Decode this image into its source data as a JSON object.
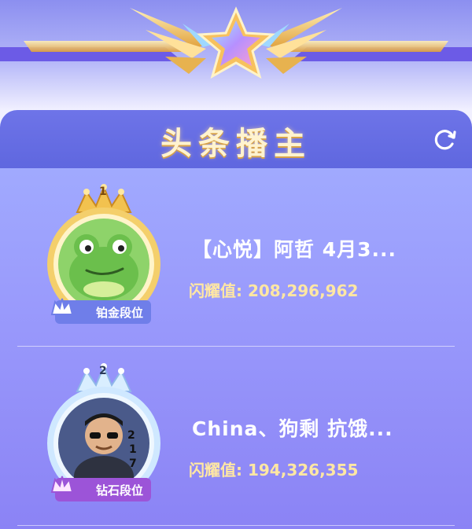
{
  "panel": {
    "title": "头条播主"
  },
  "icons": {
    "refresh": "refresh-icon",
    "emblem": "star-wings-emblem"
  },
  "rows": [
    {
      "rank": "1",
      "name": "【心悦】阿哲 4月3...",
      "score_label": "闪耀值:",
      "score_value": "208,296,962",
      "badge": "铂金段位",
      "avatar": "frog-avatar",
      "ring_color": "#f3c653",
      "badge_color": "#6f7ee9"
    },
    {
      "rank": "2",
      "name": "China、狗剩 抗饿...",
      "score_label": "闪耀值:",
      "score_value": "194,326,355",
      "badge": "钻石段位",
      "avatar": "person-avatar",
      "ring_color": "#bfe2ff",
      "badge_color": "#9c54d8"
    }
  ]
}
